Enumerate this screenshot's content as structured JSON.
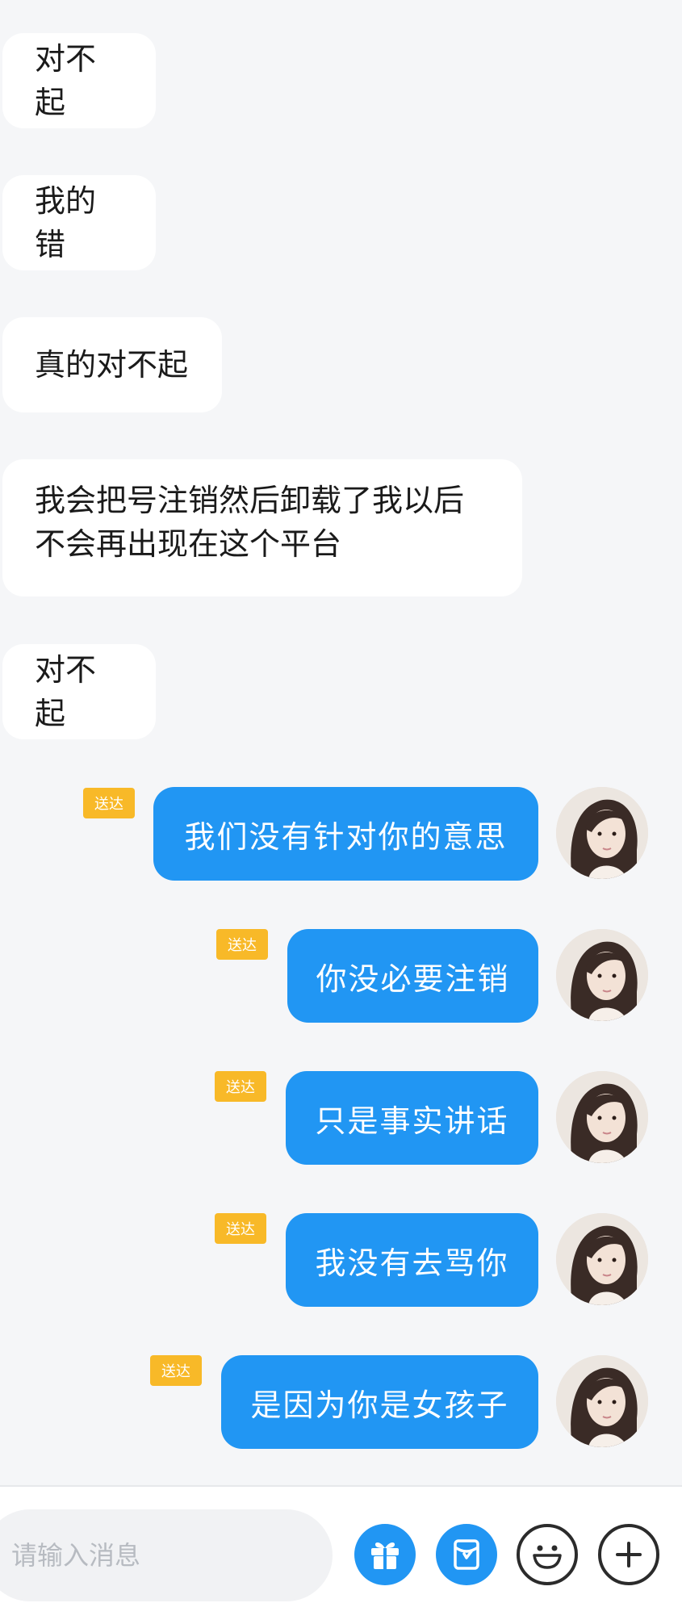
{
  "incoming": [
    {
      "text": "对不起"
    },
    {
      "text": "我的错"
    },
    {
      "text": "真的对不起"
    },
    {
      "text": "我会把号注销然后卸载了我以后不会再出现在这个平台"
    },
    {
      "text": "对不起"
    }
  ],
  "outgoing": [
    {
      "text": "我们没有针对你的意思",
      "status": "送达"
    },
    {
      "text": "你没必要注销",
      "status": "送达"
    },
    {
      "text": "只是事实讲话",
      "status": "送达"
    },
    {
      "text": "我没有去骂你",
      "status": "送达"
    },
    {
      "text": "是因为你是女孩子",
      "status": "送达"
    }
  ],
  "composer": {
    "placeholder": "请输入消息",
    "icons": [
      "gift-icon",
      "red-packet-icon",
      "emoji-icon",
      "add-icon"
    ]
  },
  "colors": {
    "accent": "#2196f3",
    "badge": "#f8b928",
    "background": "#f5f6f8"
  }
}
